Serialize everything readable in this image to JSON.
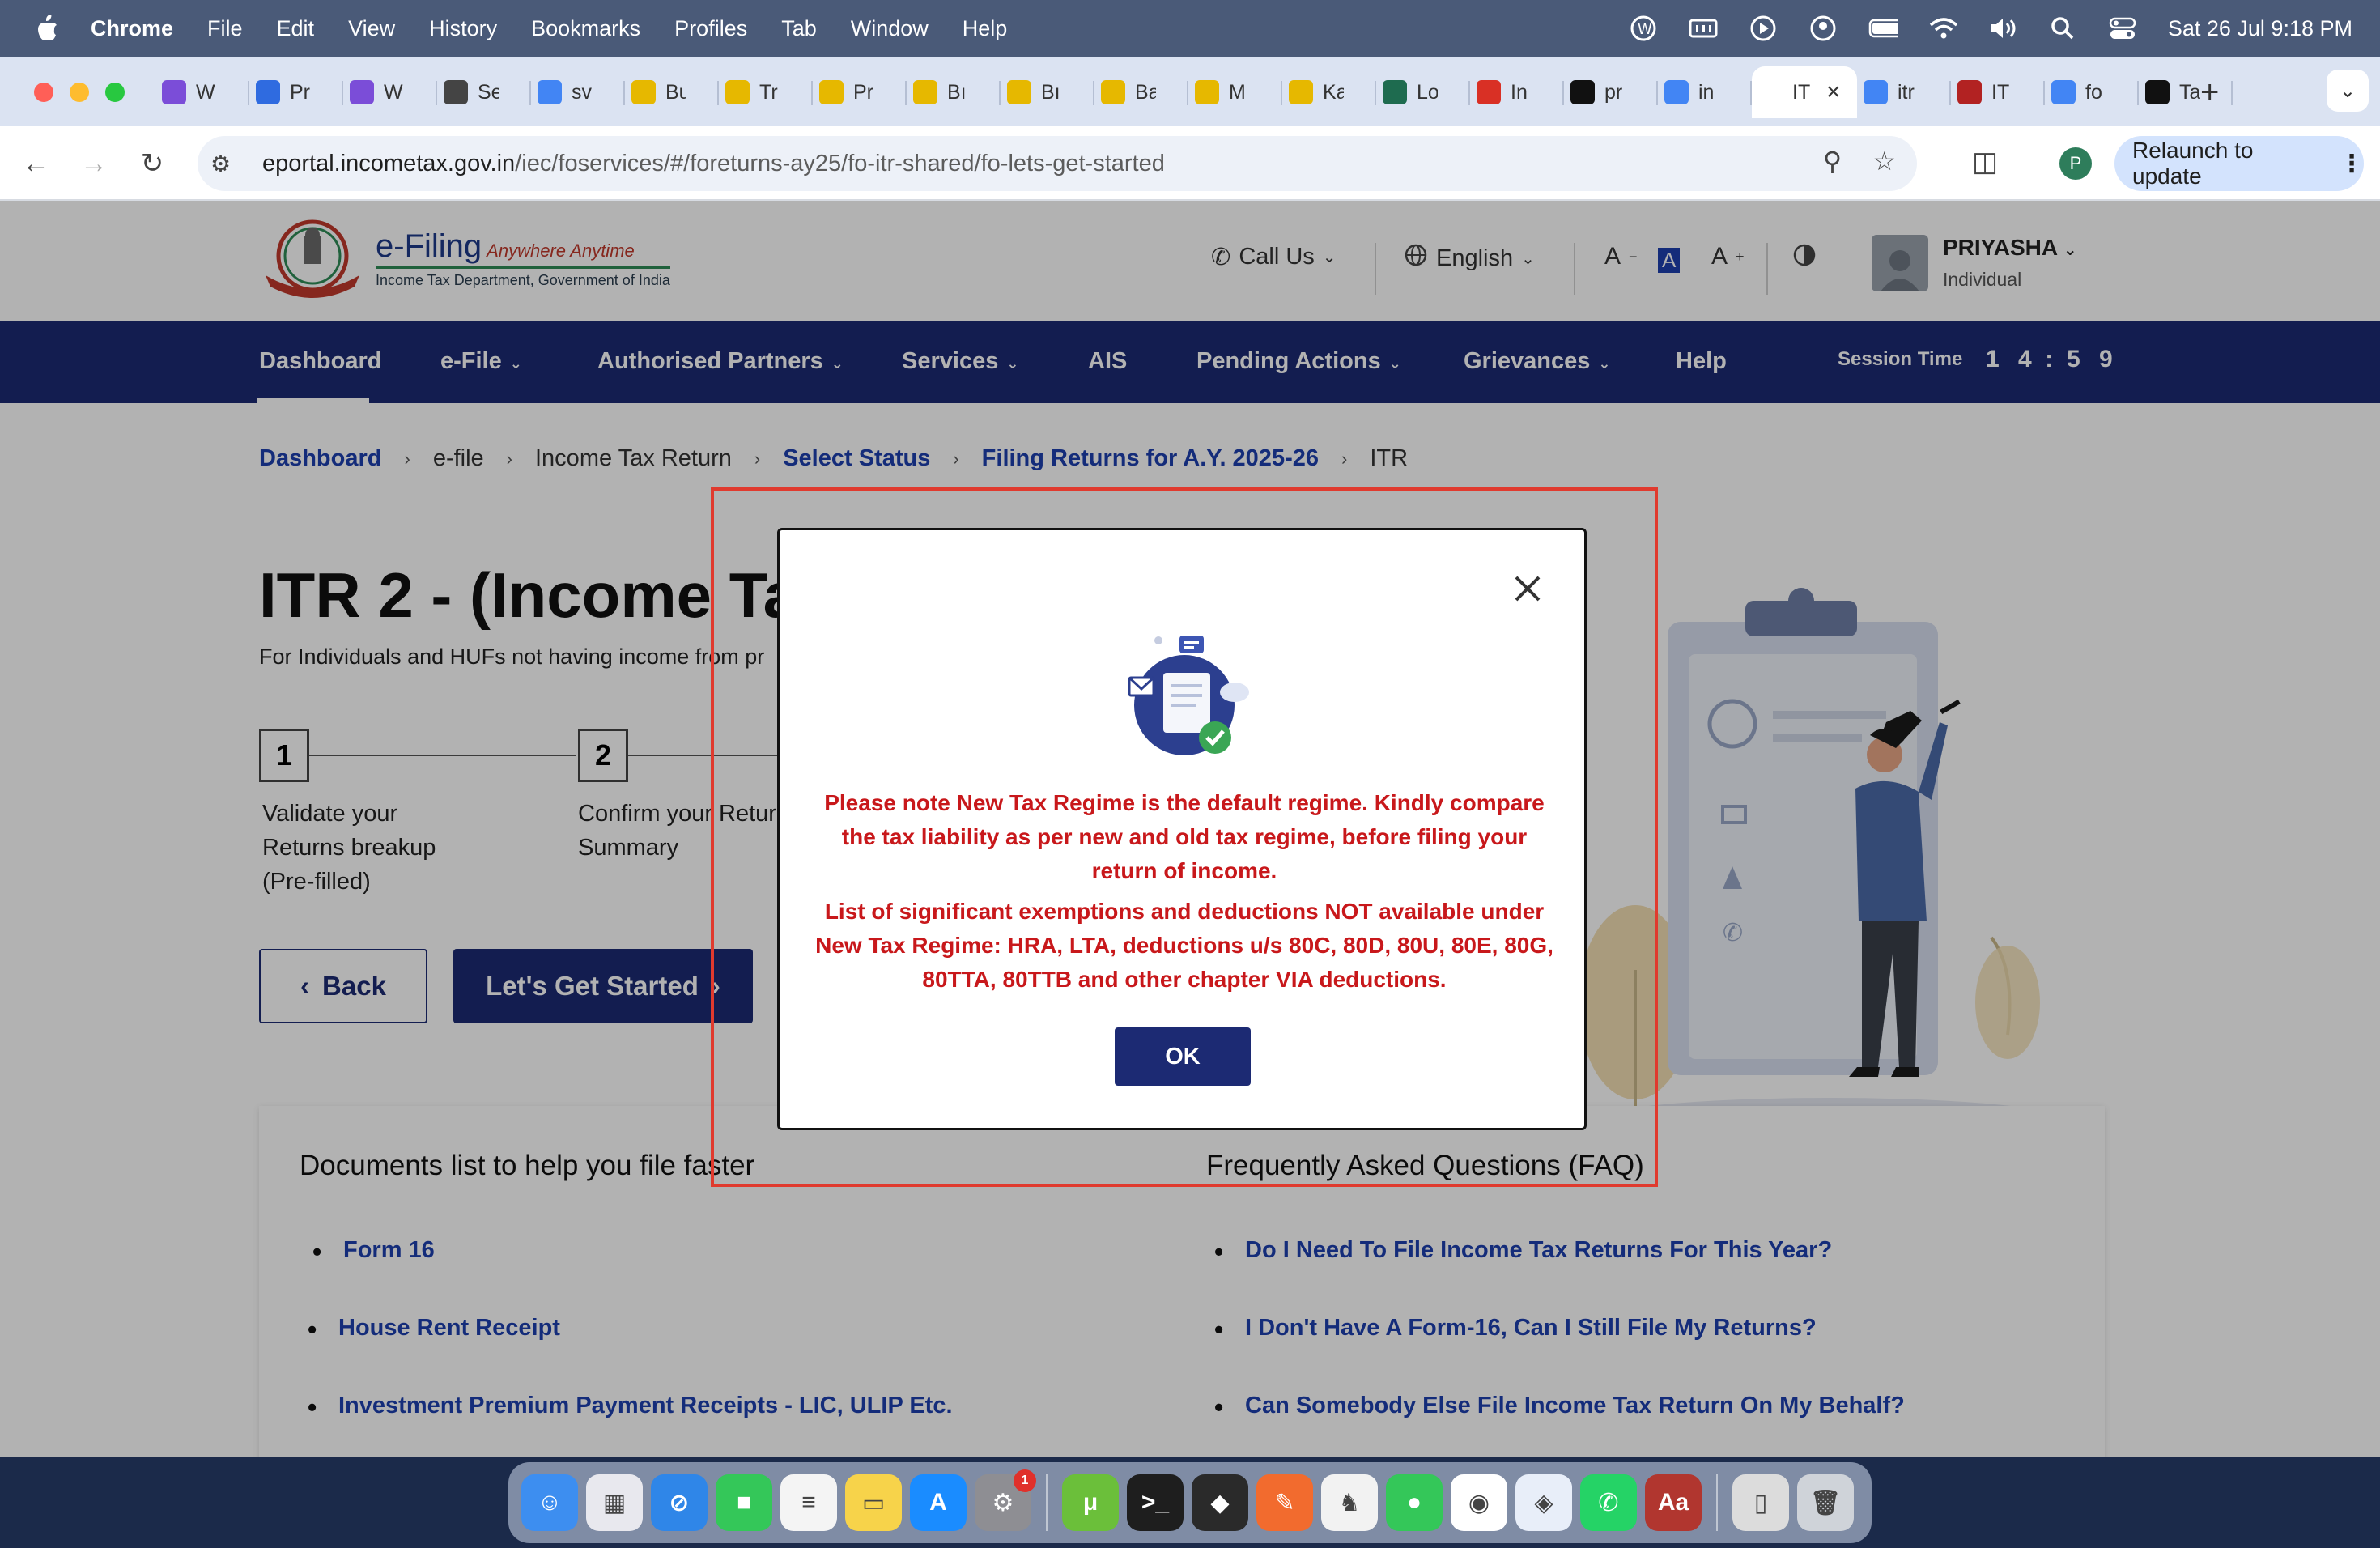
{
  "menubar": {
    "items": [
      "Chrome",
      "File",
      "Edit",
      "View",
      "History",
      "Bookmarks",
      "Profiles",
      "Tab",
      "Window",
      "Help"
    ],
    "clock": "Sat 26 Jul  9:18 PM"
  },
  "tabs": [
    {
      "title": "W",
      "icon": "star-app-icon",
      "color": "#7b4dd8"
    },
    {
      "title": "Pr",
      "icon": "play-icon",
      "color": "#2f6be0"
    },
    {
      "title": "W",
      "icon": "star-app-icon",
      "color": "#7b4dd8"
    },
    {
      "title": "Se",
      "icon": "bottle-icon",
      "color": "#444444"
    },
    {
      "title": "sv",
      "icon": "google-icon",
      "color": "#4285f4"
    },
    {
      "title": "Bu",
      "icon": "coin-icon",
      "color": "#e6b800"
    },
    {
      "title": "Tr",
      "icon": "coin-icon",
      "color": "#e6b800"
    },
    {
      "title": "Pr",
      "icon": "coin-icon",
      "color": "#e6b800"
    },
    {
      "title": "Bı",
      "icon": "coin-icon",
      "color": "#e6b800"
    },
    {
      "title": "Bı",
      "icon": "coin-icon",
      "color": "#e6b800"
    },
    {
      "title": "Ba",
      "icon": "coin-icon",
      "color": "#e6b800"
    },
    {
      "title": "M",
      "icon": "coin-icon",
      "color": "#e6b800"
    },
    {
      "title": "Ka",
      "icon": "coin-icon",
      "color": "#e6b800"
    },
    {
      "title": "Lo",
      "icon": "leaf-icon",
      "color": "#1e6b4f"
    },
    {
      "title": "In",
      "icon": "gmail-icon",
      "color": "#d93025"
    },
    {
      "title": "pr",
      "icon": "github-icon",
      "color": "#111111"
    },
    {
      "title": "in",
      "icon": "google-icon",
      "color": "#4285f4"
    },
    {
      "title": "IT",
      "icon": "blank-icon",
      "color": "#ffffff",
      "active": true
    },
    {
      "title": "itr",
      "icon": "google-icon",
      "color": "#4285f4"
    },
    {
      "title": "IT",
      "icon": "emblem-icon",
      "color": "#b22222"
    },
    {
      "title": "fo",
      "icon": "google-icon",
      "color": "#4285f4"
    },
    {
      "title": "Ta",
      "icon": "inb-icon",
      "color": "#111111"
    }
  ],
  "address": {
    "domain": "eportal.incometax.gov.in",
    "path": "/iec/foservices/#/foreturns-ay25/fo-itr-shared/fo-lets-get-started",
    "profile_initial": "P",
    "relaunch": "Relaunch to update"
  },
  "header": {
    "efiling": "e-Filing",
    "tagline": "Anywhere Anytime",
    "dept": "Income Tax Department, Government of India",
    "call_us": "Call Us",
    "language": "English",
    "font_dec": "A",
    "font_norm": "A",
    "font_inc": "A",
    "user_name": "PRIYASHA",
    "user_role": "Individual"
  },
  "nav": {
    "items": [
      "Dashboard",
      "e-File",
      "Authorised Partners",
      "Services",
      "AIS",
      "Pending Actions",
      "Grievances",
      "Help"
    ],
    "session_label": "Session Time",
    "session_digits": [
      "1",
      "4",
      "5",
      "9"
    ]
  },
  "breadcrumb": [
    "Dashboard",
    "e-file",
    "Income Tax Return",
    "Select Status",
    "Filing Returns for A.Y. 2025-26",
    "ITR"
  ],
  "page": {
    "title": "ITR 2 - (Income Ta",
    "subtitle": "For Individuals and HUFs not having income from pr",
    "steps": [
      {
        "num": "1",
        "label_lines": [
          "Validate your",
          "Returns breakup",
          "(Pre-filled)"
        ]
      },
      {
        "num": "2",
        "label_lines": [
          "Confirm your Retur",
          "Summary"
        ]
      }
    ],
    "back_label": "Back",
    "start_label": "Let's Get Started"
  },
  "docs": {
    "heading": "Documents list to help you file faster",
    "items": [
      "Form 16",
      "House Rent Receipt",
      "Investment Premium Payment Receipts - LIC, ULIP Etc."
    ]
  },
  "faq": {
    "heading": "Frequently Asked Questions (FAQ)",
    "items": [
      "Do I Need To File Income Tax Returns For This Year?",
      "I Don't Have A Form-16, Can I Still File My Returns?",
      "Can Somebody Else File Income Tax Return On My Behalf?"
    ]
  },
  "modal": {
    "para1": "Please note New Tax Regime is the default regime. Kindly compare the tax liability as per new and old tax regime, before filing your return of income.",
    "para2": "List of significant exemptions and deductions NOT available under New Tax Regime: HRA, LTA, deductions u/s 80C, 80D, 80U, 80E, 80G, 80TTA, 80TTB and other chapter VIA deductions.",
    "ok": "OK"
  },
  "dock": {
    "apps": [
      {
        "name": "finder-icon",
        "color": "#3d8ef0",
        "glyph": "☺"
      },
      {
        "name": "launchpad-icon",
        "color": "#e8e8ee",
        "glyph": "▦"
      },
      {
        "name": "safari-icon",
        "color": "#2f86e8",
        "glyph": "⊘"
      },
      {
        "name": "facetime-icon",
        "color": "#34c759",
        "glyph": "■"
      },
      {
        "name": "reminders-icon",
        "color": "#f4f4f4",
        "glyph": "≡"
      },
      {
        "name": "notes-icon",
        "color": "#f7d34a",
        "glyph": "▭"
      },
      {
        "name": "app-store-icon",
        "color": "#1a8cff",
        "glyph": "A"
      },
      {
        "name": "system-settings-icon",
        "color": "#8e8e93",
        "glyph": "⚙",
        "badge": "1"
      },
      {
        "name": "utorrent-icon",
        "color": "#6bbf3a",
        "glyph": "μ"
      },
      {
        "name": "terminal-icon",
        "color": "#1e1e1e",
        "glyph": ">_"
      },
      {
        "name": "package-icon",
        "color": "#2a2a2a",
        "glyph": "◆"
      },
      {
        "name": "pen-app-icon",
        "color": "#f26b2e",
        "glyph": "✎"
      },
      {
        "name": "reader-icon",
        "color": "#f2f2f2",
        "glyph": "♞"
      },
      {
        "name": "messages-icon",
        "color": "#34c759",
        "glyph": "●"
      },
      {
        "name": "chrome-icon",
        "color": "#ffffff",
        "glyph": "◉"
      },
      {
        "name": "shield-app-icon",
        "color": "#e8eef9",
        "glyph": "◈"
      },
      {
        "name": "whatsapp-icon",
        "color": "#25d366",
        "glyph": "✆"
      },
      {
        "name": "dictionary-icon",
        "color": "#b1362f",
        "glyph": "Aa"
      },
      {
        "name": "preview-icon",
        "color": "#dcdcdc",
        "glyph": "▯"
      },
      {
        "name": "trash-icon",
        "color": "#cfd3d9",
        "glyph": "🗑"
      }
    ]
  }
}
